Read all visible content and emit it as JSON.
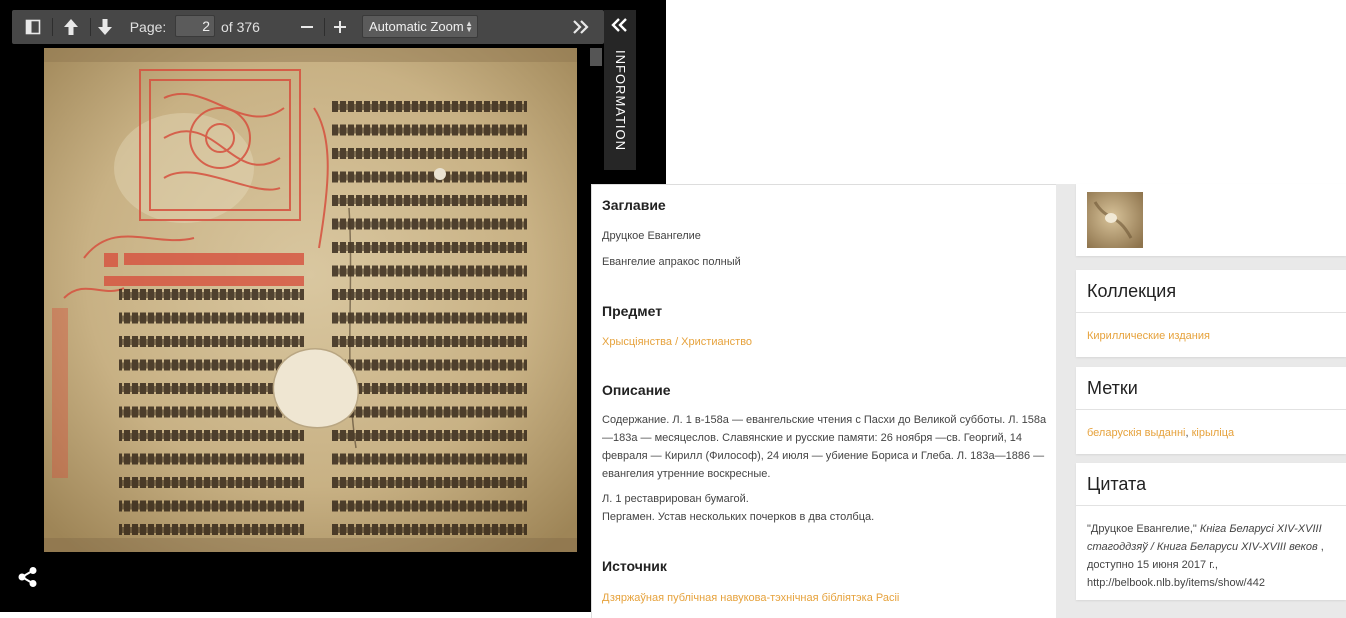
{
  "viewer": {
    "page_label": "Page:",
    "page_value": "2",
    "page_total": "of 376",
    "zoom_option": "Automatic Zoom",
    "info_label": "INFORMATION"
  },
  "metadata": {
    "title_heading": "Заглавие",
    "title_values": [
      "Друцкое Евангелие",
      "Евангелие апракос полный"
    ],
    "subject_heading": "Предмет",
    "subject_link": "Хрысціянства / Христианство",
    "description_heading": "Описание",
    "description_p1": "Содержание. Л. 1 в-158а — евангельские чтения с Пасхи до Великой субботы. Л. 158а—183а — месяцеслов. Славянские и русские памяти: 26 ноября —св. Георгий, 14 февраля — Кирилл (Философ), 24 июля — убиение Бориса и Глеба. Л. 183а—1886 — евангелия утренние воскресные.",
    "description_p2": "Л. 1 реставрирован бумагой.",
    "description_p3": "Пергамен. Устав нескольких почерков в два столбца.",
    "source_heading": "Источник",
    "source_link": "Дзяржаўная публічная навукова-тэхнічная бібліятэка Расіі"
  },
  "sidebar": {
    "collection_heading": "Коллекция",
    "collection_link": "Кириллические издания",
    "tags_heading": "Метки",
    "tags": [
      "беларускія выданні",
      "кірыліца"
    ],
    "tags_separator": ", ",
    "citation_heading": "Цитата",
    "citation_quote": "\"Друцкое Евангелие,\" ",
    "citation_italic": "Кніга Беларусі XIV-XVIII стагоддзяў / Книга Беларуси XIV-XVIII веков",
    "citation_rest": " , доступно 15 июня 2017 г., http://belbook.nlb.by/items/show/442"
  },
  "colors": {
    "link": "#e6a23c",
    "viewer_bg": "#000000",
    "toolbar_bg": "#474747",
    "sidebar_bg": "#e9e9e9"
  },
  "icons": [
    "sidebar-toggle-icon",
    "arrow-up-icon",
    "arrow-down-icon",
    "minus-icon",
    "plus-icon",
    "double-chevron-right-icon",
    "double-chevron-left-icon",
    "share-icon"
  ]
}
